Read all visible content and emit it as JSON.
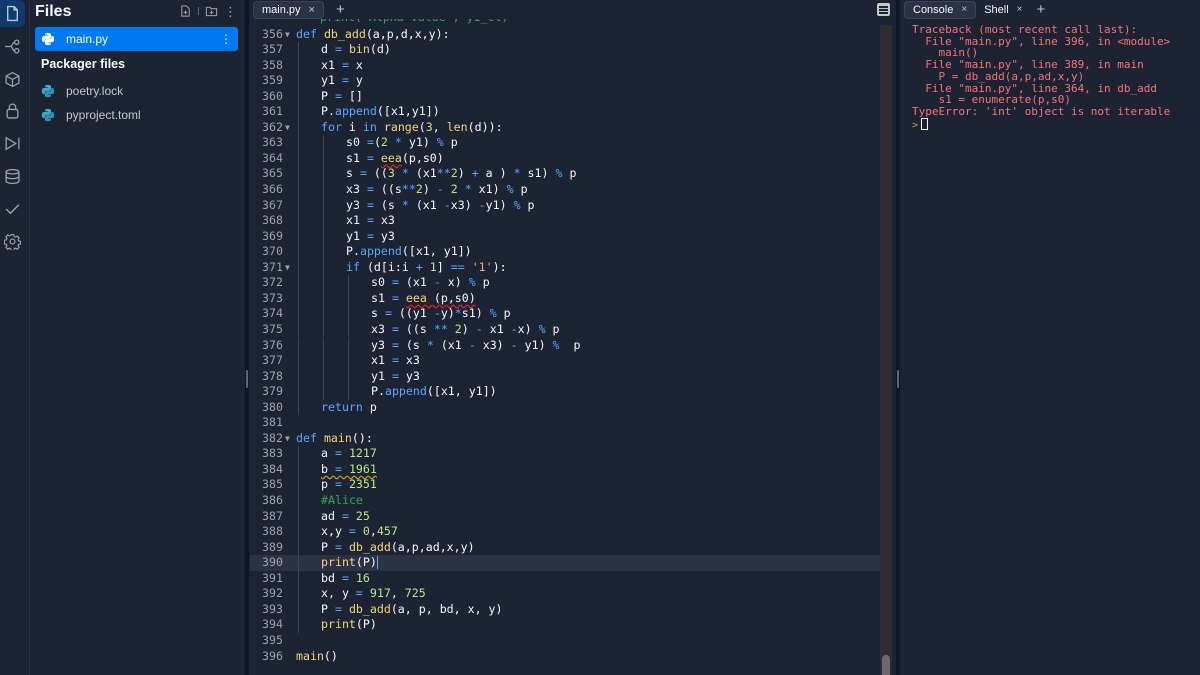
{
  "activity_bar": {
    "items": [
      {
        "name": "files",
        "icon": "file-icon",
        "active": true
      },
      {
        "name": "git",
        "icon": "git-branch-icon"
      },
      {
        "name": "packages",
        "icon": "cube-icon"
      },
      {
        "name": "secrets",
        "icon": "lock-icon"
      },
      {
        "name": "debugger",
        "icon": "debug-play-icon"
      },
      {
        "name": "database",
        "icon": "database-icon"
      },
      {
        "name": "unit-tests",
        "icon": "check-icon"
      },
      {
        "name": "settings",
        "icon": "gear-icon"
      }
    ]
  },
  "files_panel": {
    "title": "Files",
    "new_file_icon": "new-file-icon",
    "new_folder_icon": "new-folder-icon",
    "more_icon": "kebab-icon",
    "files": [
      {
        "name": "main.py",
        "active": true
      }
    ],
    "packager_title": "Packager files",
    "packager_files": [
      {
        "name": "poetry.lock"
      },
      {
        "name": "pyproject.toml"
      }
    ]
  },
  "editor": {
    "tabs": [
      {
        "label": "main.py",
        "close": "×"
      }
    ],
    "add_tab": "+",
    "active_line": 390,
    "lines": [
      {
        "n": 356,
        "fold": true,
        "indent": 0,
        "html": "<span class='kw'>def</span> <span class='fn'>db_add</span>(a,p,d,x,y):"
      },
      {
        "n": 357,
        "indent": 1,
        "html": "d <span class='op'>=</span> <span class='fn'>bin</span>(d)"
      },
      {
        "n": 358,
        "indent": 1,
        "html": "x1 <span class='op'>=</span> x"
      },
      {
        "n": 359,
        "indent": 1,
        "html": "y1 <span class='op'>=</span> y"
      },
      {
        "n": 360,
        "indent": 1,
        "html": "P <span class='op'>=</span> []"
      },
      {
        "n": 361,
        "indent": 1,
        "html": "P.<span class='kw'>append</span>([x1,y1])"
      },
      {
        "n": 362,
        "fold": true,
        "indent": 1,
        "html": "<span class='kw'>for</span> i <span class='kw'>in</span> <span class='fn'>range</span>(<span class='num'>3</span>, <span class='fn'>len</span>(d)):"
      },
      {
        "n": 363,
        "indent": 2,
        "html": "s0 <span class='op'>=</span>(<span class='num'>2</span> <span class='op'>*</span> y1) <span class='op'>%</span> p"
      },
      {
        "n": 364,
        "indent": 2,
        "html": "s1 <span class='op'>=</span> <span class='fn squig'>eea</span>(p,s0)"
      },
      {
        "n": 365,
        "indent": 2,
        "html": "s <span class='op'>=</span> ((<span class='num'>3</span> <span class='op'>*</span> (x1<span class='op'>**</span><span class='num'>2</span>) <span class='op'>+</span> a ) <span class='op'>*</span> s1) <span class='op'>%</span> p"
      },
      {
        "n": 366,
        "indent": 2,
        "html": "x3 <span class='op'>=</span> ((s<span class='op'>**</span><span class='num'>2</span>) <span class='op'>-</span> <span class='num'>2</span> <span class='op'>*</span> x1) <span class='op'>%</span> p"
      },
      {
        "n": 367,
        "indent": 2,
        "html": "y3 <span class='op'>=</span> (s <span class='op'>*</span> (x1 <span class='op'>-</span>x3) <span class='op'>-</span>y1) <span class='op'>%</span> p"
      },
      {
        "n": 368,
        "indent": 2,
        "html": "x1 <span class='op'>=</span> x3"
      },
      {
        "n": 369,
        "indent": 2,
        "html": "y1 <span class='op'>=</span> y3"
      },
      {
        "n": 370,
        "indent": 2,
        "html": "P.<span class='kw'>append</span>([x1, y1])"
      },
      {
        "n": 371,
        "fold": true,
        "indent": 2,
        "html": "<span class='kw'>if</span> (d[i:i <span class='op'>+</span> <span class='num'>1</span>] <span class='op'>==</span> <span class='str'>'1'</span>):"
      },
      {
        "n": 372,
        "indent": 3,
        "html": "s0 <span class='op'>=</span> (x1 <span class='op'>-</span> x) <span class='op'>%</span> p"
      },
      {
        "n": 373,
        "indent": 3,
        "html": "s1 <span class='op'>=</span> <span class='fn squig'>eea</span><span class='squig'> (p,s0)</span>"
      },
      {
        "n": 374,
        "indent": 3,
        "html": "s <span class='op'>=</span> ((y1 <span class='op'>-</span>y)<span class='op'>*</span>s1) <span class='op'>%</span> p"
      },
      {
        "n": 375,
        "indent": 3,
        "html": "x3 <span class='op'>=</span> ((s <span class='op'>**</span> <span class='num'>2</span>) <span class='op'>-</span> x1 <span class='op'>-</span>x) <span class='op'>%</span> p"
      },
      {
        "n": 376,
        "indent": 3,
        "html": "y3 <span class='op'>=</span> (s <span class='op'>*</span> (x1 <span class='op'>-</span> x3) <span class='op'>-</span> y1) <span class='op'>%</span>  p"
      },
      {
        "n": 377,
        "indent": 3,
        "html": "x1 <span class='op'>=</span> x3"
      },
      {
        "n": 378,
        "indent": 3,
        "html": "y1 <span class='op'>=</span> y3"
      },
      {
        "n": 379,
        "indent": 3,
        "html": "P.<span class='kw'>append</span>([x1, y1])"
      },
      {
        "n": 380,
        "indent": 1,
        "html": "<span class='kw'>return</span> p"
      },
      {
        "n": 381,
        "indent": 0,
        "html": ""
      },
      {
        "n": 382,
        "fold": true,
        "indent": 0,
        "html": "<span class='kw'>def</span> <span class='fn'>main</span>():"
      },
      {
        "n": 383,
        "indent": 1,
        "html": "a <span class='op'>=</span> <span class='num'>1217</span>"
      },
      {
        "n": 384,
        "indent": 1,
        "html": "<span class='squig-y'>b <span class='op'>=</span> <span class='num'>1961</span></span>"
      },
      {
        "n": 385,
        "indent": 1,
        "html": "p <span class='op'>=</span> <span class='num'>2351</span>"
      },
      {
        "n": 386,
        "indent": 1,
        "html": "<span class='cm'>#Alice</span>"
      },
      {
        "n": 387,
        "indent": 1,
        "html": "ad <span class='op'>=</span> <span class='num'>25</span>"
      },
      {
        "n": 388,
        "indent": 1,
        "html": "x,y <span class='op'>=</span> <span class='num'>0</span>,<span class='num'>457</span>"
      },
      {
        "n": 389,
        "indent": 1,
        "html": "P <span class='op'>=</span> <span class='fn'>db_add</span>(a,p,ad,x,y)"
      },
      {
        "n": 390,
        "indent": 1,
        "html": "<span class='fn'>print</span>(P)<span class='cursor'></span>"
      },
      {
        "n": 391,
        "indent": 1,
        "html": "bd <span class='op'>=</span> <span class='num'>16</span>"
      },
      {
        "n": 392,
        "indent": 1,
        "html": "x, y <span class='op'>=</span> <span class='num'>917</span>, <span class='num'>725</span>"
      },
      {
        "n": 393,
        "indent": 1,
        "html": "P <span class='op'>=</span> <span class='fn'>db_add</span>(a, p, bd, x, y)"
      },
      {
        "n": 394,
        "indent": 1,
        "html": "<span class='fn'>print</span>(P)"
      },
      {
        "n": 395,
        "indent": 0,
        "html": ""
      },
      {
        "n": 396,
        "indent": 0,
        "html": "<span class='fn'>main</span>()"
      }
    ]
  },
  "console": {
    "tabs": [
      {
        "label": "Console",
        "close": "×",
        "active": true
      },
      {
        "label": "Shell",
        "close": "×"
      }
    ],
    "add_tab": "+",
    "output": [
      "Traceback (most recent call last):",
      "  File \"main.py\", line 396, in <module>",
      "    main()",
      "  File \"main.py\", line 389, in main",
      "    P = db_add(a,p,ad,x,y)",
      "  File \"main.py\", line 364, in db_add",
      "    s1 = enumerate(p,s0)",
      "TypeError: 'int' object is not iterable"
    ],
    "prompt": ">"
  }
}
